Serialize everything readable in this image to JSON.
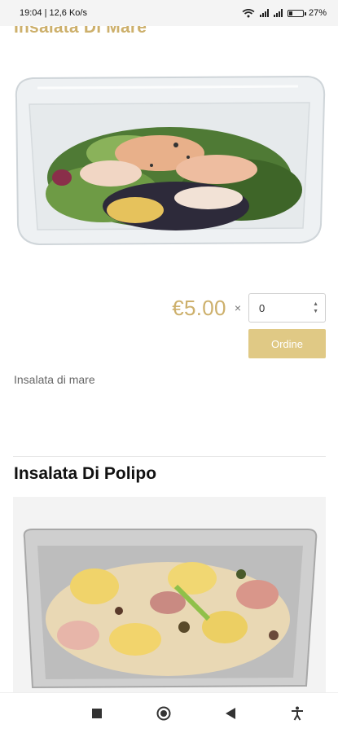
{
  "status_bar": {
    "time_speed": "19:04 | 12,6 Ko/s",
    "battery": "27%",
    "battery_level": 0.27
  },
  "products": [
    {
      "title": "Insalata Di Mare",
      "price": "€5.00",
      "times": "×",
      "quantity": "0",
      "order_label": "Ordine",
      "description": "Insalata di mare"
    },
    {
      "title": "Insalata Di Polipo"
    }
  ],
  "icons": {
    "wifi": "wifi-icon",
    "signal": "signal-icon",
    "battery": "battery-icon",
    "recents": "square-icon",
    "home": "circle-icon",
    "back": "triangle-back-icon",
    "accessibility": "accessibility-icon",
    "stepper_up": "chevron-up-icon",
    "stepper_down": "chevron-down-icon"
  },
  "colors": {
    "accent": "#cdb06c",
    "button": "#e0c985"
  }
}
